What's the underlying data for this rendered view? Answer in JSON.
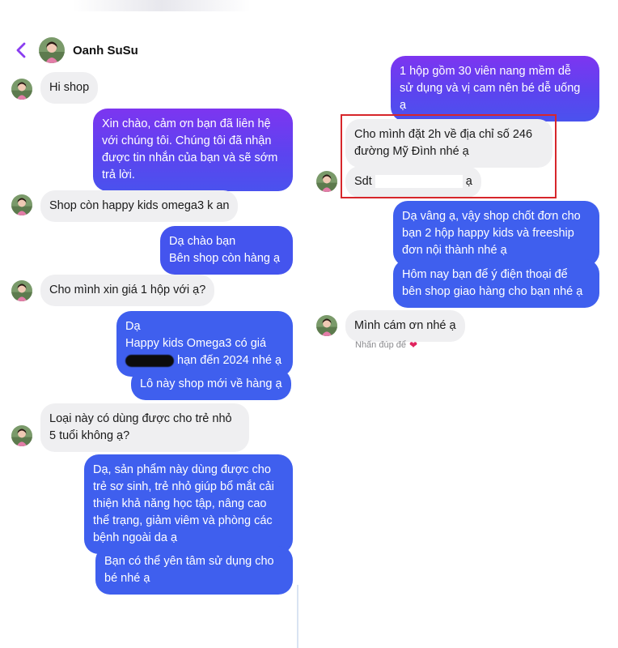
{
  "contact": {
    "name": "Oanh SuSu"
  },
  "colors": {
    "outgoing_top": "#7d35f0",
    "outgoing_bottom": "#4a52ee",
    "incoming": "#efeff1",
    "highlight": "#d7262b"
  },
  "messages_left": [
    {
      "from": "customer",
      "text": "Hi shop"
    },
    {
      "from": "shop",
      "lines": [
        "Xin chào, cảm ơn bạn đã liên hệ",
        "với chúng tôi. Chúng tôi đã nhận",
        "được tin nhắn của bạn và sẽ sớm",
        "trả lời."
      ]
    },
    {
      "from": "customer",
      "text": "Shop còn happy kids omega3 k an"
    },
    {
      "from": "shop",
      "lines": [
        "Dạ chào bạn",
        "Bên shop còn hàng ạ"
      ]
    },
    {
      "from": "customer",
      "text": "Cho mình xin giá 1 hộp với ạ?"
    },
    {
      "from": "shop",
      "lines": [
        "Dạ",
        "Happy kids Omega3 có giá",
        "hạn đến 2024 nhé ạ"
      ]
    },
    {
      "from": "shop",
      "text": "Lô này shop mới về hàng ạ"
    },
    {
      "from": "customer",
      "lines": [
        "Loại này có dùng được cho trẻ nhỏ",
        "5 tuổi không ạ?"
      ]
    },
    {
      "from": "shop",
      "lines": [
        "Dạ, sản phẩm này dùng được cho",
        "trẻ sơ sinh, trẻ nhỏ giúp bổ mắt cải",
        "thiện khả năng học tập, nâng cao",
        "thể trạng, giảm viêm và phòng các",
        "bệnh ngoài da ạ"
      ]
    },
    {
      "from": "shop",
      "lines": [
        "Bạn có thể yên tâm sử dụng cho",
        "bé nhé ạ"
      ]
    }
  ],
  "messages_right": [
    {
      "from": "shop",
      "lines": [
        "1 hộp gồm 30 viên nang mềm dễ",
        "sử dụng và vị cam nên bé dễ uống",
        "ạ"
      ]
    },
    {
      "from": "customer",
      "lines": [
        "Cho mình đặt 2h về địa chỉ số 246",
        "đường Mỹ Đình nhé ạ"
      ]
    },
    {
      "from": "customer",
      "prefix": "Sdt",
      "suffix": "ạ"
    },
    {
      "from": "shop",
      "lines": [
        "Dạ vâng ạ, vậy shop chốt đơn cho",
        "bạn 2 hộp happy kids và freeship",
        "đơn nội thành nhé ạ"
      ]
    },
    {
      "from": "shop",
      "lines": [
        "Hôm nay bạn để ý điện thoại để",
        "bên shop giao hàng cho bạn nhé ạ"
      ]
    },
    {
      "from": "customer",
      "text": "Mình cám ơn nhé ạ"
    }
  ],
  "reaction": {
    "text": "Nhấn đúp để",
    "icon": "heart-icon"
  }
}
